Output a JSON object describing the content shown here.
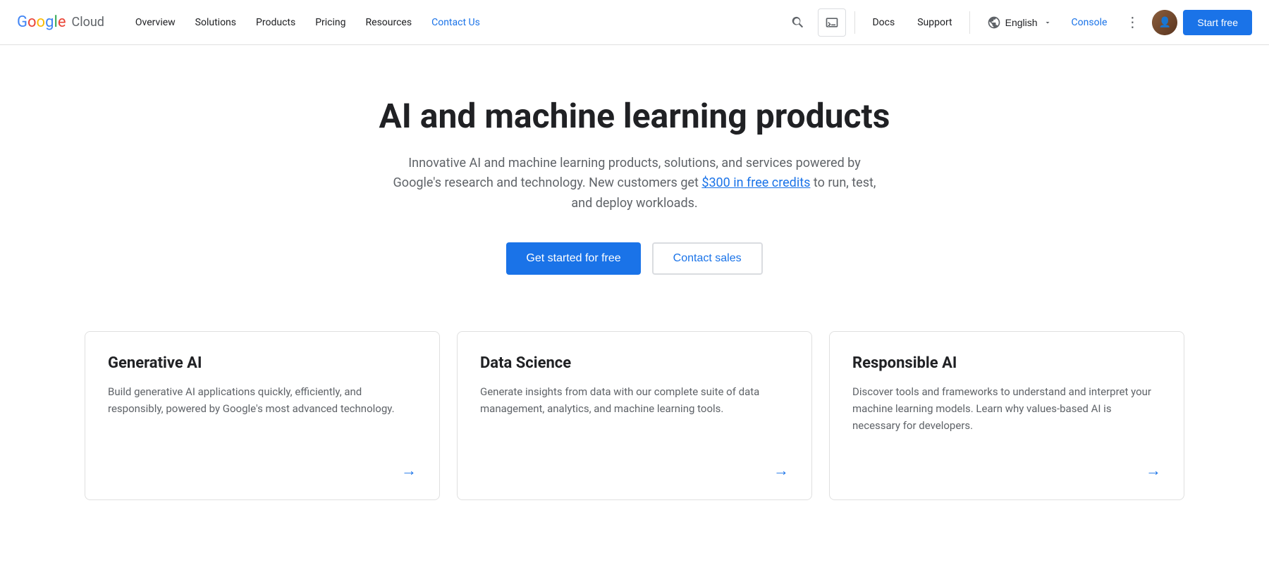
{
  "navbar": {
    "logo_google": "Google",
    "logo_cloud": "Cloud",
    "nav_items": [
      {
        "id": "overview",
        "label": "Overview"
      },
      {
        "id": "solutions",
        "label": "Solutions"
      },
      {
        "id": "products",
        "label": "Products"
      },
      {
        "id": "pricing",
        "label": "Pricing"
      },
      {
        "id": "resources",
        "label": "Resources"
      },
      {
        "id": "contact-us",
        "label": "Contact Us",
        "active": true
      }
    ],
    "docs_label": "Docs",
    "support_label": "Support",
    "language_label": "English",
    "console_label": "Console",
    "start_free_label": "Start free"
  },
  "hero": {
    "title": "AI and machine learning products",
    "subtitle_before_link": "Innovative AI and machine learning products, solutions, and services powered by Google's research and technology. New customers get ",
    "link_text": "$300 in free credits",
    "subtitle_after_link": " to run, test, and deploy workloads.",
    "btn_primary": "Get started for free",
    "btn_secondary": "Contact sales"
  },
  "cards": [
    {
      "id": "generative-ai",
      "title": "Generative AI",
      "description": "Build generative AI applications quickly, efficiently, and responsibly, powered by Google's most advanced technology.",
      "arrow": "→"
    },
    {
      "id": "data-science",
      "title": "Data Science",
      "description": "Generate insights from data with our complete suite of data management, analytics, and machine learning tools.",
      "arrow": "→"
    },
    {
      "id": "responsible-ai",
      "title": "Responsible AI",
      "description": "Discover tools and frameworks to understand and interpret your machine learning models. Learn why values-based AI is necessary for developers.",
      "arrow": "→"
    }
  ],
  "colors": {
    "primary_blue": "#1a73e8",
    "text_dark": "#202124",
    "text_muted": "#5f6368",
    "border": "#e0e0e0",
    "bg": "#fff"
  }
}
